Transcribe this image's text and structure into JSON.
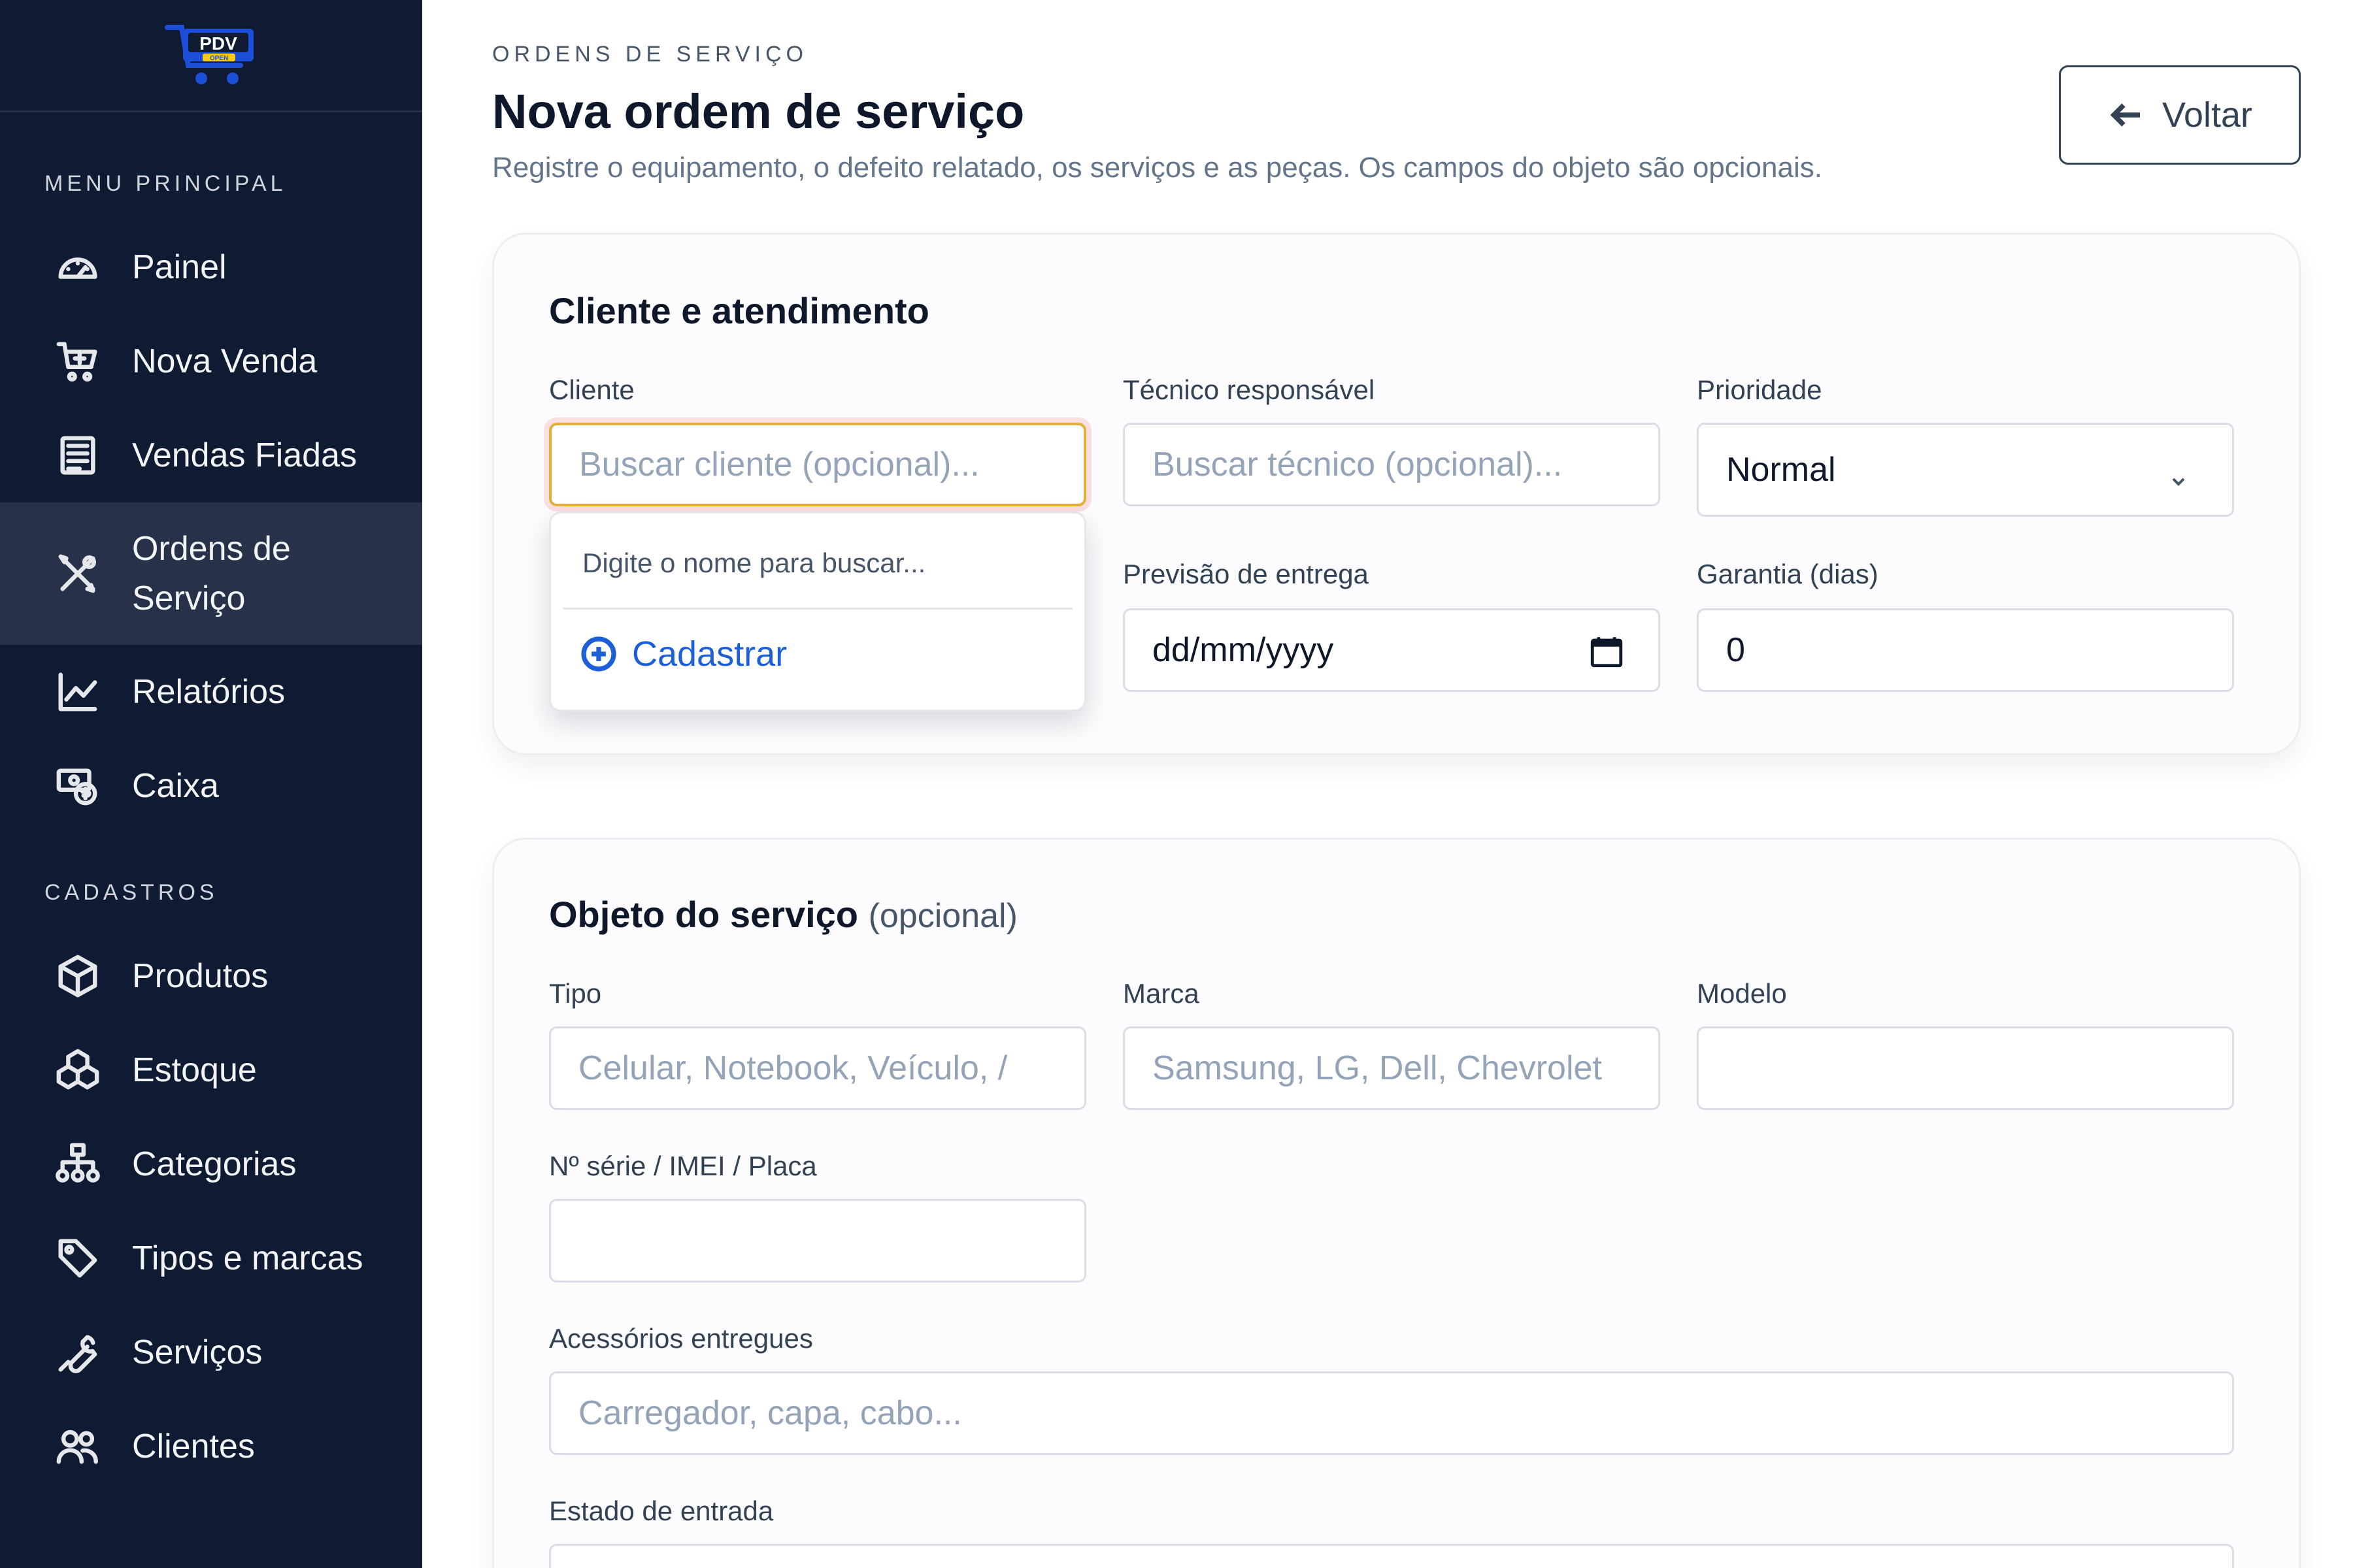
{
  "sidebar": {
    "sections": [
      {
        "label": "MENU PRINCIPAL",
        "items": [
          {
            "label": "Painel",
            "icon": "dashboard-gauge-icon"
          },
          {
            "label": "Nova Venda",
            "icon": "cart-plus-icon"
          },
          {
            "label": "Vendas Fiadas",
            "icon": "receipt-list-icon"
          },
          {
            "label": "Ordens de Serviço",
            "icon": "tools-cross-icon",
            "active": true
          },
          {
            "label": "Relatórios",
            "icon": "line-chart-icon"
          },
          {
            "label": "Caixa",
            "icon": "cash-register-icon"
          }
        ]
      },
      {
        "label": "CADASTROS",
        "items": [
          {
            "label": "Produtos",
            "icon": "box-icon"
          },
          {
            "label": "Estoque",
            "icon": "boxes-stack-icon"
          },
          {
            "label": "Categorias",
            "icon": "hierarchy-icon"
          },
          {
            "label": "Tipos e marcas",
            "icon": "tags-icon"
          },
          {
            "label": "Serviços",
            "icon": "wrench-icon"
          },
          {
            "label": "Clientes",
            "icon": "users-icon"
          }
        ]
      }
    ],
    "logo_text": "PDV",
    "logo_sub": "OPEN"
  },
  "header": {
    "eyebrow": "ORDENS DE SERVIÇO",
    "title": "Nova ordem de serviço",
    "subtitle": "Registre o equipamento, o defeito relatado, os serviços e as peças. Os campos do objeto são opcionais.",
    "back_label": "Voltar"
  },
  "card_client": {
    "title": "Cliente e atendimento",
    "cliente": {
      "label": "Cliente",
      "placeholder": "Buscar cliente (opcional)..."
    },
    "tecnico": {
      "label": "Técnico responsável",
      "placeholder": "Buscar técnico (opcional)..."
    },
    "prioridade": {
      "label": "Prioridade",
      "value": "Normal"
    },
    "previsao": {
      "label": "Previsão de entrega",
      "value": "dd/mm/yyyy"
    },
    "garantia": {
      "label": "Garantia (dias)",
      "value": "0"
    },
    "dropdown": {
      "hint": "Digite o nome para buscar...",
      "add_label": "Cadastrar"
    }
  },
  "card_object": {
    "title": "Objeto do serviço",
    "title_optional": "(opcional)",
    "tipo": {
      "label": "Tipo",
      "placeholder": "Celular, Notebook, Veículo, /"
    },
    "marca": {
      "label": "Marca",
      "placeholder": "Samsung, LG, Dell, Chevrolet"
    },
    "modelo": {
      "label": "Modelo",
      "value": ""
    },
    "serie": {
      "label": "Nº série / IMEI / Placa",
      "value": ""
    },
    "acessorios": {
      "label": "Acessórios entregues",
      "placeholder": "Carregador, capa, cabo..."
    },
    "estado": {
      "label": "Estado de entrada"
    }
  },
  "colors": {
    "sidebar_bg": "#0f1b33",
    "sidebar_active": "#27324a",
    "accent_link": "#1d5fd6",
    "focus_border": "#e2b13b"
  }
}
